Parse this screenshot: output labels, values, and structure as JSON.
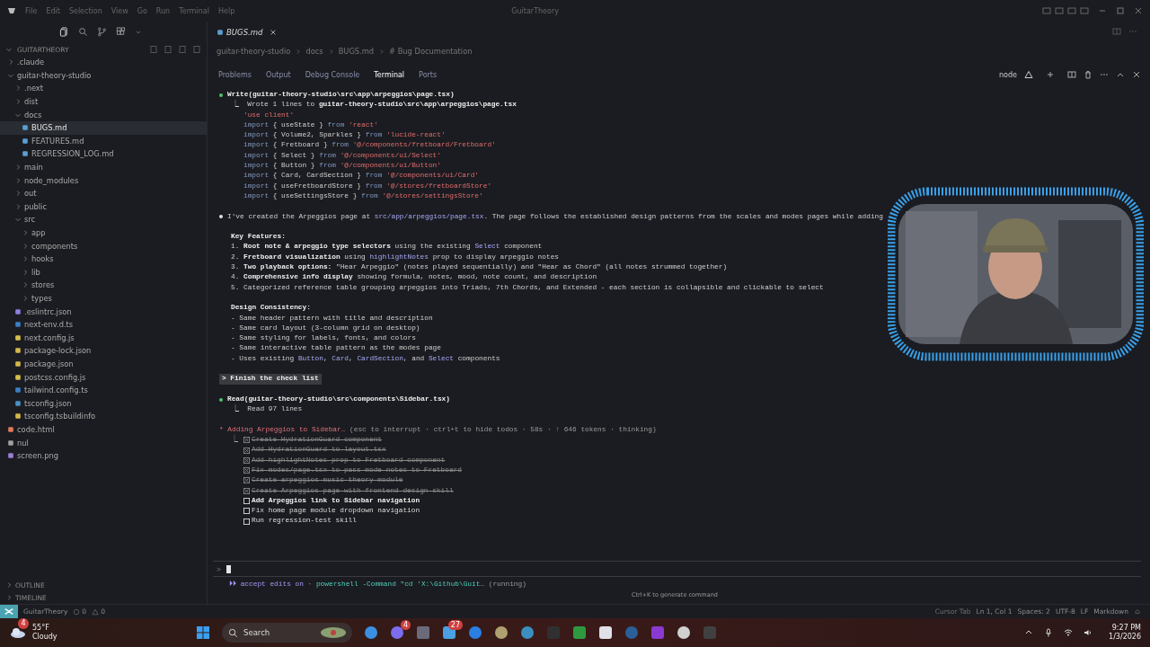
{
  "title_bar": {
    "menus": [
      "File",
      "Edit",
      "Selection",
      "View",
      "Go",
      "Run",
      "Terminal",
      "Help"
    ],
    "title": "GuitarTheory"
  },
  "explorer": {
    "title": "GUITARTHEORY",
    "tree": [
      {
        "name": ".claude",
        "kind": "folder",
        "expanded": false,
        "selected": false
      },
      {
        "name": "guitar-theory-studio",
        "kind": "folder",
        "expanded": true,
        "selected": false,
        "children": [
          {
            "name": ".next",
            "kind": "folder",
            "expanded": false,
            "selected": false
          },
          {
            "name": "dist",
            "kind": "folder",
            "expanded": false,
            "selected": false
          },
          {
            "name": "docs",
            "kind": "folder",
            "expanded": true,
            "selected": false,
            "children": [
              {
                "name": "BUGS.md",
                "kind": "markdown",
                "selected": true
              },
              {
                "name": "FEATURES.md",
                "kind": "markdown",
                "selected": false
              },
              {
                "name": "REGRESSION_LOG.md",
                "kind": "markdown",
                "selected": false
              }
            ]
          },
          {
            "name": "main",
            "kind": "folder",
            "expanded": false,
            "selected": false
          },
          {
            "name": "node_modules",
            "kind": "folder",
            "expanded": false,
            "selected": false
          },
          {
            "name": "out",
            "kind": "folder",
            "expanded": false,
            "selected": false
          },
          {
            "name": "public",
            "kind": "folder",
            "expanded": false,
            "selected": false
          },
          {
            "name": "src",
            "kind": "folder",
            "expanded": true,
            "selected": false,
            "children": [
              {
                "name": "app",
                "kind": "folder",
                "expanded": false,
                "selected": false
              },
              {
                "name": "components",
                "kind": "folder",
                "expanded": false,
                "selected": false
              },
              {
                "name": "hooks",
                "kind": "folder",
                "expanded": false,
                "selected": false
              },
              {
                "name": "lib",
                "kind": "folder",
                "expanded": false,
                "selected": false
              },
              {
                "name": "stores",
                "kind": "folder",
                "expanded": false,
                "selected": false
              },
              {
                "name": "types",
                "kind": "folder",
                "expanded": false,
                "selected": false
              }
            ]
          },
          {
            "name": ".eslintrc.json",
            "kind": "eslint",
            "selected": false
          },
          {
            "name": "next-env.d.ts",
            "kind": "ts",
            "selected": false
          },
          {
            "name": "next.config.js",
            "kind": "js",
            "selected": false
          },
          {
            "name": "package-lock.json",
            "kind": "json",
            "selected": false
          },
          {
            "name": "package.json",
            "kind": "json",
            "selected": false
          },
          {
            "name": "postcss.config.js",
            "kind": "js",
            "selected": false
          },
          {
            "name": "tailwind.config.ts",
            "kind": "ts",
            "selected": false
          },
          {
            "name": "tsconfig.json",
            "kind": "tsconfig",
            "selected": false
          },
          {
            "name": "tsconfig.tsbuildinfo",
            "kind": "json",
            "selected": false
          }
        ]
      },
      {
        "name": "code.html",
        "kind": "html",
        "selected": false
      },
      {
        "name": "nul",
        "kind": "text",
        "selected": false
      },
      {
        "name": "screen.png",
        "selected": false
      }
    ],
    "sections": [
      "OUTLINE",
      "TIMELINE"
    ]
  },
  "editor": {
    "tab": "BUGS.md",
    "breadcrumb": [
      "guitar-theory-studio",
      "docs",
      "BUGS.md",
      "# Bug Documentation"
    ]
  },
  "panel": {
    "tabs": [
      {
        "label": "Problems",
        "selected": false
      },
      {
        "label": "Output",
        "selected": false
      },
      {
        "label": "Debug Console",
        "selected": false
      },
      {
        "label": "Terminal",
        "selected": true
      },
      {
        "label": "Ports",
        "selected": false
      }
    ],
    "terminal_name": "node",
    "blocks": [
      {
        "kind": "tool",
        "lines": [
          {
            "kind": "head",
            "parts": [
              {
                "kind": "bold",
                "text": "Write(guitar-theory-studio\\src\\app\\arpeggios\\page.tsx)"
              }
            ]
          },
          {
            "kind": "result",
            "parts": [
              {
                "kind": "plain",
                "text": "⎿  Wrote 1 lines to "
              },
              {
                "kind": "bold",
                "text": "guitar-theory-studio\\src\\app\\arpeggios\\page.tsx"
              }
            ]
          },
          {
            "kind": "code",
            "parts": [
              {
                "kind": "string",
                "text": "'use client'"
              }
            ]
          },
          {
            "kind": "code",
            "parts": [
              {
                "kind": "keyword",
                "text": "import"
              },
              {
                "kind": "plain",
                "text": " { useState } "
              },
              {
                "kind": "keyword",
                "text": "from"
              },
              {
                "kind": "string",
                "text": " 'react'"
              }
            ]
          },
          {
            "kind": "code",
            "parts": [
              {
                "kind": "keyword",
                "text": "import"
              },
              {
                "kind": "plain",
                "text": " { Volume2, Sparkles } "
              },
              {
                "kind": "keyword",
                "text": "from"
              },
              {
                "kind": "string",
                "text": " 'lucide-react'"
              }
            ]
          },
          {
            "kind": "code",
            "parts": [
              {
                "kind": "keyword",
                "text": "import"
              },
              {
                "kind": "plain",
                "text": " { Fretboard } "
              },
              {
                "kind": "keyword",
                "text": "from"
              },
              {
                "kind": "string",
                "text": " '@/components/fretboard/Fretboard'"
              }
            ]
          },
          {
            "kind": "code",
            "parts": [
              {
                "kind": "keyword",
                "text": "import"
              },
              {
                "kind": "plain",
                "text": " { Select } "
              },
              {
                "kind": "keyword",
                "text": "from"
              },
              {
                "kind": "string",
                "text": " '@/components/ui/Select'"
              }
            ]
          },
          {
            "kind": "code",
            "parts": [
              {
                "kind": "keyword",
                "text": "import"
              },
              {
                "kind": "plain",
                "text": " { Button } "
              },
              {
                "kind": "keyword",
                "text": "from"
              },
              {
                "kind": "string",
                "text": " '@/components/ui/Button'"
              }
            ]
          },
          {
            "kind": "code",
            "parts": [
              {
                "kind": "keyword",
                "text": "import"
              },
              {
                "kind": "plain",
                "text": " { Card, CardSection } "
              },
              {
                "kind": "keyword",
                "text": "from"
              },
              {
                "kind": "string",
                "text": " '@/components/ui/Card'"
              }
            ]
          },
          {
            "kind": "code",
            "parts": [
              {
                "kind": "keyword",
                "text": "import"
              },
              {
                "kind": "plain",
                "text": " { useFretboardStore } "
              },
              {
                "kind": "keyword",
                "text": "from"
              },
              {
                "kind": "string",
                "text": " '@/stores/fretboardStore'"
              }
            ]
          },
          {
            "kind": "code",
            "parts": [
              {
                "kind": "keyword",
                "text": "import"
              },
              {
                "kind": "plain",
                "text": " { useSettingsStore } "
              },
              {
                "kind": "keyword",
                "text": "from"
              },
              {
                "kind": "string",
                "text": " '@/stores/settingsStore'"
              }
            ]
          }
        ]
      },
      {
        "kind": "message",
        "lines": [
          {
            "kind": "head",
            "parts": [
              {
                "kind": "plain",
                "text": "I've created the Arpeggios page at "
              },
              {
                "kind": "link",
                "text": "src/app/arpeggios/page.tsx"
              },
              {
                "kind": "plain",
                "text": ". The page follows the established design patterns from the scales and modes pages while adding"
              }
            ]
          }
        ]
      },
      {
        "kind": "text",
        "lines": [
          {
            "kind": "text",
            "parts": [
              {
                "kind": "bold",
                "text": "Key Features:"
              }
            ]
          },
          {
            "kind": "text",
            "parts": [
              {
                "kind": "plain",
                "text": "1. "
              },
              {
                "kind": "bold",
                "text": "Root note & arpeggio type selectors"
              },
              {
                "kind": "plain",
                "text": " using the existing "
              },
              {
                "kind": "link",
                "text": "Select"
              },
              {
                "kind": "plain",
                "text": " component"
              }
            ]
          },
          {
            "kind": "text",
            "parts": [
              {
                "kind": "plain",
                "text": "2. "
              },
              {
                "kind": "bold",
                "text": "Fretboard visualization"
              },
              {
                "kind": "plain",
                "text": " using "
              },
              {
                "kind": "link",
                "text": "highlightNotes"
              },
              {
                "kind": "plain",
                "text": " prop to display arpeggio notes"
              }
            ]
          },
          {
            "kind": "text",
            "parts": [
              {
                "kind": "plain",
                "text": "3. "
              },
              {
                "kind": "bold",
                "text": "Two playback options:"
              },
              {
                "kind": "plain",
                "text": " \"Hear Arpeggio\" (notes played sequentially) and \"Hear as Chord\" (all notes strummed together)"
              }
            ]
          },
          {
            "kind": "text",
            "parts": [
              {
                "kind": "plain",
                "text": "4. "
              },
              {
                "kind": "bold",
                "text": "Comprehensive info display"
              },
              {
                "kind": "plain",
                "text": " showing formula, notes, mood, note count, and description"
              }
            ]
          },
          {
            "kind": "text",
            "parts": [
              {
                "kind": "plain",
                "text": "5. Categorized reference table grouping arpeggios into Triads, 7th Chords, and Extended - each section is collapsible and clickable to select"
              }
            ]
          }
        ]
      },
      {
        "kind": "text",
        "lines": [
          {
            "kind": "text",
            "parts": [
              {
                "kind": "bold",
                "text": "Design Consistency:"
              }
            ]
          },
          {
            "kind": "text",
            "parts": [
              {
                "kind": "plain",
                "text": "- Same header pattern with title and description"
              }
            ]
          },
          {
            "kind": "text",
            "parts": [
              {
                "kind": "plain",
                "text": "- Same card layout (3-column grid on desktop)"
              }
            ]
          },
          {
            "kind": "text",
            "parts": [
              {
                "kind": "plain",
                "text": "- Same styling for labels, fonts, and colors"
              }
            ]
          },
          {
            "kind": "text",
            "parts": [
              {
                "kind": "plain",
                "text": "- Same interactive table pattern as the modes page"
              }
            ]
          },
          {
            "kind": "text",
            "parts": [
              {
                "kind": "plain",
                "text": "- Uses existing "
              },
              {
                "kind": "link",
                "text": "Button"
              },
              {
                "kind": "plain",
                "text": ", "
              },
              {
                "kind": "link",
                "text": "Card"
              },
              {
                "kind": "plain",
                "text": ", "
              },
              {
                "kind": "link",
                "text": "CardSection"
              },
              {
                "kind": "plain",
                "text": ", and "
              },
              {
                "kind": "link",
                "text": "Select"
              },
              {
                "kind": "plain",
                "text": " components"
              }
            ]
          }
        ]
      },
      {
        "kind": "user",
        "lines": [
          {
            "kind": "head",
            "parts": [
              {
                "kind": "bold",
                "text": "> Finish the check list"
              }
            ]
          }
        ]
      },
      {
        "kind": "tool",
        "lines": [
          {
            "kind": "head",
            "parts": [
              {
                "kind": "bold",
                "text": "Read(guitar-theory-studio\\src\\components\\Sidebar.tsx)"
              }
            ]
          },
          {
            "kind": "result",
            "parts": [
              {
                "kind": "plain",
                "text": "⎿  Read 97 lines"
              }
            ]
          }
        ]
      },
      {
        "kind": "status",
        "lines": [
          {
            "kind": "head",
            "parts": [
              {
                "kind": "accent",
                "text": "* Adding Arpeggios to Sidebar…"
              },
              {
                "kind": "muted",
                "text": " (esc to interrupt · ctrl+t to hide todos · 58s · ↑ 646 tokens · thinking)"
              }
            ]
          }
        ],
        "todo_prefix": "⎿",
        "todos": [
          {
            "text": "Create HydrationGuard component",
            "done": true,
            "active": false
          },
          {
            "text": "Add HydrationGuard to layout.tsx",
            "done": true,
            "active": false
          },
          {
            "text": "Add highlightNotes prop to Fretboard component",
            "done": true,
            "active": false
          },
          {
            "text": "Fix modes/page.tsx to pass mode notes to Fretboard",
            "done": true,
            "active": false
          },
          {
            "text": "Create arpeggios music theory module",
            "done": true,
            "active": false
          },
          {
            "text": "Create Arpeggios page with frontend-design skill",
            "done": true,
            "active": false
          },
          {
            "text": "Add Arpeggios link to Sidebar navigation",
            "done": false,
            "active": true
          },
          {
            "text": "Fix home page module dropdown navigation",
            "done": false,
            "active": false
          },
          {
            "text": "Run regression-test skill",
            "done": false,
            "active": false
          }
        ]
      }
    ],
    "prompt": ">",
    "footer": [
      {
        "kind": "purple",
        "text": "⏵⏵ accept edits on"
      },
      {
        "kind": "muted",
        "text": " · "
      },
      {
        "kind": "teal",
        "text": "powershell -Command \"cd 'X:\\Github\\Guit…"
      },
      {
        "kind": "muted",
        "text": " (running)"
      }
    ],
    "hint": "Ctrl+K to generate command"
  },
  "status_bar": {
    "workspace": "GuitarTheory",
    "errors": "0",
    "warnings": "0",
    "right": [
      "Cursor Tab",
      "Ln 1, Col 1",
      "Spaces: 2",
      "UTF-8",
      "LF",
      "Markdown"
    ]
  },
  "taskbar": {
    "weather_badge": "4",
    "temperature": "55°F",
    "condition": "Cloudy",
    "search": {
      "placeholder": "Search"
    },
    "app_badges": [
      "4",
      "27"
    ],
    "time": "9:27 PM",
    "date": "1/3/2026"
  }
}
